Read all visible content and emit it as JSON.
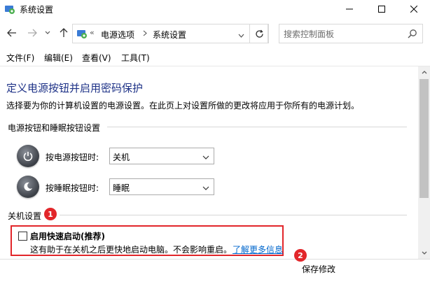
{
  "window": {
    "title": "系统设置"
  },
  "address": {
    "overflow": "«",
    "crumbs": [
      "电源选项",
      "系统设置"
    ]
  },
  "search": {
    "placeholder": "搜索控制面板"
  },
  "menu": [
    "文件(F)",
    "编辑(E)",
    "查看(V)",
    "工具(T)"
  ],
  "main": {
    "heading": "定义电源按钮并启用密码保护",
    "description": "选择要为你的计算机设置的电源设置。在此页上对设置所做的更改将应用于你所有的电源计划。",
    "power_section": {
      "label": "电源按钮和睡眠按钮设置",
      "power_button": {
        "label": "按电源按钮时:",
        "value": "关机"
      },
      "sleep_button": {
        "label": "按睡眠按钮时:",
        "value": "睡眠"
      }
    },
    "shutdown_section": {
      "label": "关机设置",
      "fast_startup": {
        "label": "启用快速启动(推荐)",
        "checked": false,
        "description": "这有助于在关机之后更快地启动电脑。不会影响重启。",
        "link": "了解更多信息"
      }
    }
  },
  "annotations": {
    "badge1": "1",
    "badge2": "2"
  },
  "footer": {
    "save_label": "保存修改"
  },
  "colors": {
    "heading": "#1e3287",
    "link": "#0066cc",
    "highlight": "#e2262a"
  }
}
